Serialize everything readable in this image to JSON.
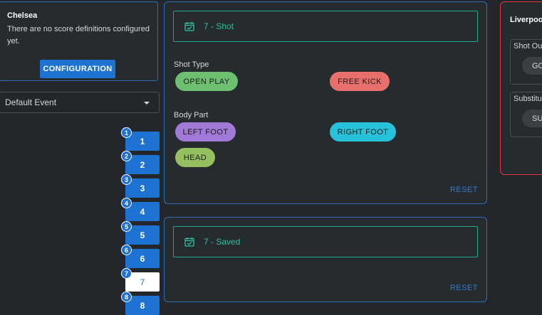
{
  "home_team": {
    "name": "Chelsea",
    "message": "There are no score definitions configured yet.",
    "config_button": "CONFIGURATION"
  },
  "event_select": {
    "value": "Default Event"
  },
  "tiles": [
    {
      "badge": "1",
      "label": "1"
    },
    {
      "badge": "2",
      "label": "2"
    },
    {
      "badge": "3",
      "label": "3"
    },
    {
      "badge": "4",
      "label": "4"
    },
    {
      "badge": "5",
      "label": "5"
    },
    {
      "badge": "6",
      "label": "6"
    },
    {
      "badge": "7",
      "label": "7",
      "active": true
    },
    {
      "badge": "8",
      "label": "8"
    }
  ],
  "panels": {
    "shot": {
      "title": "7 - Shot",
      "shot_type_label": "Shot Type",
      "shot_type": [
        "OPEN PLAY",
        "FREE KICK"
      ],
      "body_part_label": "Body Part",
      "body_part": [
        "LEFT FOOT",
        "RIGHT FOOT",
        "HEAD"
      ],
      "reset": "RESET"
    },
    "saved": {
      "title": "7 - Saved",
      "reset": "RESET"
    }
  },
  "away_team": {
    "name": "Liverpool",
    "shot_out_label": "Shot Out",
    "shot_out_pill": "GO",
    "sub_label": "Substitut",
    "sub_pill": "SU"
  },
  "colors": {
    "accent_blue": "#1e73d2",
    "teal": "#2fc09f",
    "chip_green": "#6cc070",
    "chip_red": "#e8706c",
    "chip_purple": "#a07ad6",
    "chip_cyan": "#27c1d9",
    "chip_lime": "#95c060",
    "away_border": "#e0353c"
  }
}
